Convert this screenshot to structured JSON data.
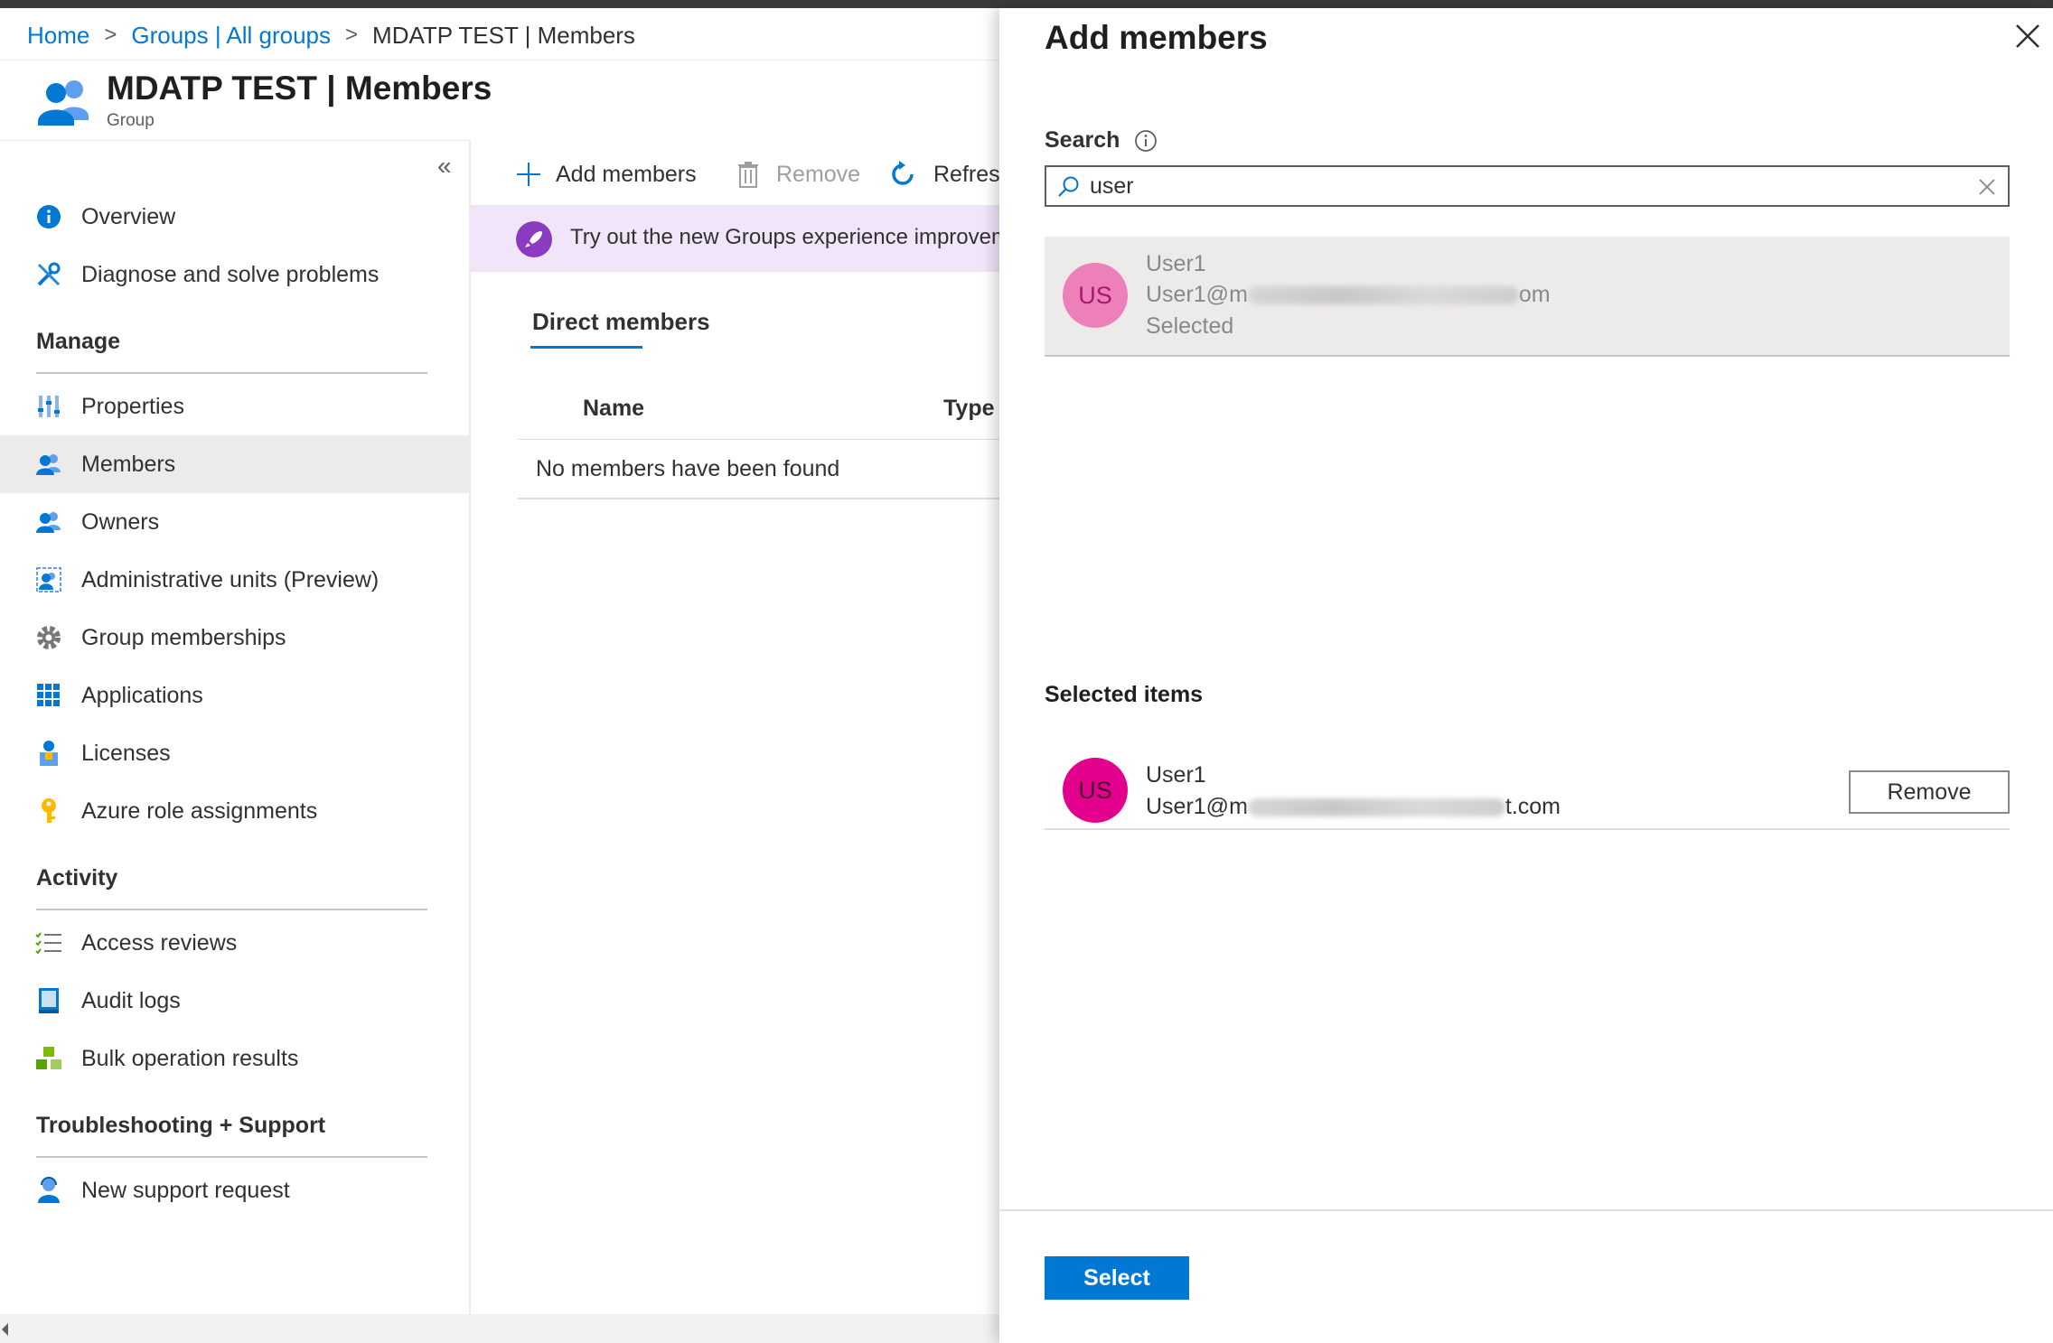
{
  "breadcrumb": {
    "home": "Home",
    "groups": "Groups | All groups",
    "current": "MDATP TEST | Members",
    "separator": ">"
  },
  "header": {
    "title": "MDATP TEST | Members",
    "subtitle": "Group",
    "icon": "group-icon"
  },
  "sidebar": {
    "collapse_label": "«",
    "items_top": [
      {
        "label": "Overview",
        "icon": "info-icon"
      },
      {
        "label": "Diagnose and solve problems",
        "icon": "wrench-icon"
      }
    ],
    "sections": [
      {
        "title": "Manage",
        "items": [
          {
            "label": "Properties",
            "icon": "properties-icon"
          },
          {
            "label": "Members",
            "icon": "members-icon",
            "active": true
          },
          {
            "label": "Owners",
            "icon": "owners-icon"
          },
          {
            "label": "Administrative units (Preview)",
            "icon": "admin-units-icon"
          },
          {
            "label": "Group memberships",
            "icon": "gear-icon"
          },
          {
            "label": "Applications",
            "icon": "apps-grid-icon"
          },
          {
            "label": "Licenses",
            "icon": "license-icon"
          },
          {
            "label": "Azure role assignments",
            "icon": "key-icon"
          }
        ]
      },
      {
        "title": "Activity",
        "items": [
          {
            "label": "Access reviews",
            "icon": "checklist-icon"
          },
          {
            "label": "Audit logs",
            "icon": "book-icon"
          },
          {
            "label": "Bulk operation results",
            "icon": "cubes-icon"
          }
        ]
      },
      {
        "title": "Troubleshooting + Support",
        "items": [
          {
            "label": "New support request",
            "icon": "support-icon"
          }
        ]
      }
    ]
  },
  "toolbar": {
    "add_members": "Add members",
    "remove": "Remove",
    "refresh": "Refres"
  },
  "banner": {
    "text": "Try out the new Groups experience improvem"
  },
  "members": {
    "tab": "Direct members",
    "columns": [
      "Name",
      "Type"
    ],
    "empty": "No members have been found"
  },
  "panel": {
    "title": "Add members",
    "search_label": "Search",
    "search_value": "user",
    "result": {
      "initials": "US",
      "name": "User1",
      "email_start": "User1@m",
      "email_end": "om",
      "status": "Selected"
    },
    "selected_title": "Selected items",
    "selected": {
      "initials": "US",
      "name": "User1",
      "email_start": "User1@m",
      "email_end": "t.com",
      "remove_label": "Remove"
    },
    "select_label": "Select"
  },
  "colors": {
    "accent": "#0078d4",
    "avatar_selected": "#e3008c",
    "avatar_result": "#ed7fb9",
    "banner_bg": "#f1e5f9"
  }
}
